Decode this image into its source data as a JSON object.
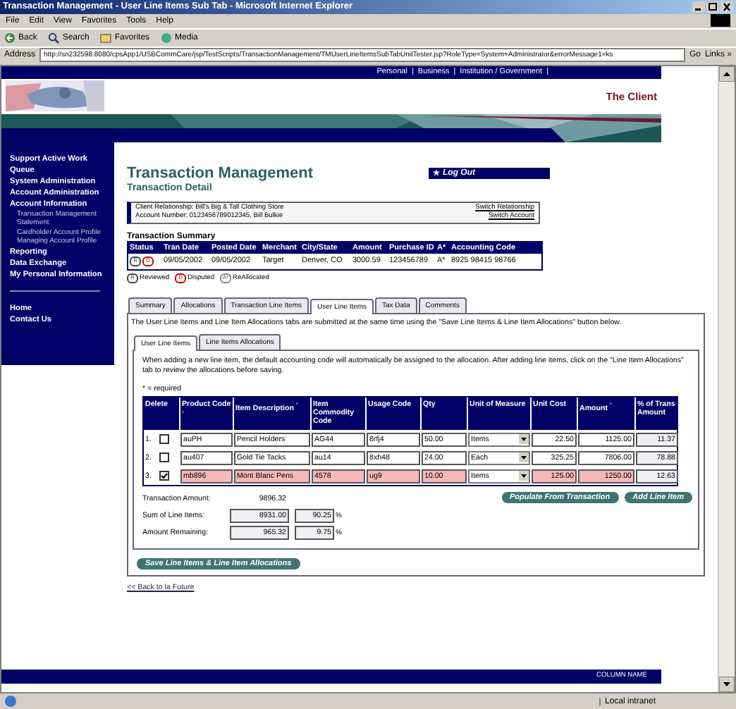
{
  "window": {
    "title": "Transaction Management - User Line Items Sub Tab - Microsoft Internet Explorer"
  },
  "menu": [
    "File",
    "Edit",
    "View",
    "Favorites",
    "Tools",
    "Help"
  ],
  "toolbar": [
    {
      "label": "Back",
      "kind": "back"
    },
    {
      "label": "Search",
      "kind": "search"
    },
    {
      "label": "Favorites",
      "kind": "favorites"
    },
    {
      "label": "Media",
      "kind": "media"
    }
  ],
  "address": {
    "label": "Address",
    "url": "http://sn232598:8080/cpsApp1/USBCommCare/jsp/TestScripts/TransactionManagement/TMUserLineItemsSubTabUnitTester.jsp?RoleType=System+Administrator&errorMessage1=ks",
    "go": "Go",
    "links": "Links »"
  },
  "top_links": [
    "Personal",
    "|",
    "Business",
    "|",
    "Institution / Government",
    "|"
  ],
  "client_name": "The Client",
  "sidebar": {
    "items": [
      {
        "label": "Support Active Work Queue"
      },
      {
        "label": "System Administration"
      },
      {
        "label": "Account Administration"
      },
      {
        "label": "Account Information",
        "children": [
          {
            "label": "Transaction Management"
          },
          {
            "label": "Statement"
          },
          {
            "label": "Cardholder Account Profile"
          },
          {
            "label": "Managing Account Profile"
          }
        ]
      },
      {
        "label": "Reporting"
      },
      {
        "label": "Data Exchange"
      },
      {
        "label": "My Personal Information"
      }
    ],
    "footer_items": [
      "Home",
      "Contact Us"
    ]
  },
  "log_out": "Log Out",
  "page": {
    "title": "Transaction Management",
    "subtitle": "Transaction Detail"
  },
  "client_box": {
    "relationship": "Client Relationship:  Bill's Big & Tall Clothing Store",
    "account": "Account Number:  0123456789012345, Bill Bulkie",
    "links": [
      "Switch Relationship",
      "Switch Account"
    ]
  },
  "summary": {
    "title": "Transaction Summary",
    "columns": [
      "Status",
      "Tran Date",
      "Posted Date",
      "Merchant",
      "City/State",
      "Amount",
      "Purchase ID",
      "A*",
      "Accounting Code"
    ],
    "row": {
      "status": [
        {
          "mark": "R",
          "kind": "reviewed"
        },
        {
          "mark": "D",
          "kind": "disputed"
        }
      ],
      "cells": [
        "09/05/2002",
        "09/05/2002",
        "Target",
        "Denver, CO",
        "3000.59",
        "123456789",
        "A*",
        "8925 98415 98766"
      ]
    },
    "legend": [
      {
        "mark": "R",
        "label": "Reviewed",
        "kind": "reviewed"
      },
      {
        "mark": "D",
        "label": "Disputed",
        "kind": "disputed"
      },
      {
        "mark": "A*",
        "label": "ReAllocated",
        "kind": "reallocated"
      }
    ]
  },
  "tabs": [
    {
      "label": "Summary",
      "selected": false
    },
    {
      "label": "Allocations",
      "selected": false
    },
    {
      "label": "Transaction Line Items",
      "selected": false
    },
    {
      "label": "User Line Items",
      "selected": true
    },
    {
      "label": "Tax Data",
      "selected": false
    },
    {
      "label": "Comments",
      "selected": false
    }
  ],
  "notice": "The User Line Items and Line Item Allocations tabs are submitted at the same time using the \"Save Line Items & Line Item Allocations\" button below.",
  "subtabs": [
    {
      "label": "User Line Items",
      "selected": true
    },
    {
      "label": "Line Items Allocations",
      "selected": false
    }
  ],
  "instructions": "When adding a new line item, the default accounting code will automatically be assigned to the allocation. After adding line items, click on the \"Line Item Allocations\" tab to review the allocations before saving.",
  "required_note": "* = required",
  "line_items": {
    "columns": [
      "Delete",
      "Product Code $^{*}$",
      "Item Description $^{*}$",
      "Item Commodity Code",
      "Usage Code",
      "Qty",
      "Unit of Measure",
      "Unit Cost",
      "Amount $^{*}$",
      "% of Trans Amount"
    ],
    "rows": [
      {
        "number": "1.",
        "checked": false,
        "product": "auPH",
        "description": "Pencil Holders",
        "commodity": "AG44",
        "usage": "8rfj4",
        "qty": "50.00",
        "unit": "Items",
        "unit_cost": "22.50",
        "amount": "1125.00",
        "percent": "11.37"
      },
      {
        "number": "2.",
        "checked": false,
        "product": "au407",
        "description": "Gold Tie Tacks",
        "commodity": "au14",
        "usage": "8xh48",
        "qty": "24.00",
        "unit": "Each",
        "unit_cost": "325.25",
        "amount": "7806.00",
        "percent": "78.88"
      },
      {
        "number": "3.",
        "checked": true,
        "product": "mb896",
        "description": "Mont Blanc Pens",
        "commodity": "4578",
        "usage": "ug9",
        "qty": "10.00",
        "unit": "Items",
        "unit_cost": "125.00",
        "amount": "1250.00",
        "percent": "12.63"
      }
    ]
  },
  "totals": {
    "transaction_label": "Transaction Amount:",
    "transaction_value": "9896.32",
    "sum_label": "Sum of Line Items:",
    "sum_value": "8931.00",
    "sum_percent": "90.25",
    "remaining_label": "Amount Remaining:",
    "remaining_value": "965.32",
    "remaining_percent": "9.75",
    "percent_sign": "%"
  },
  "buttons": [
    "Populate From Transaction",
    "Add Line Item"
  ],
  "save_button": "Save Line Items & Line Item Allocations",
  "back_link": "<< Back to la Future",
  "footer": "COLUMN NAME",
  "status_bar": {
    "zone": "Local intranet"
  }
}
